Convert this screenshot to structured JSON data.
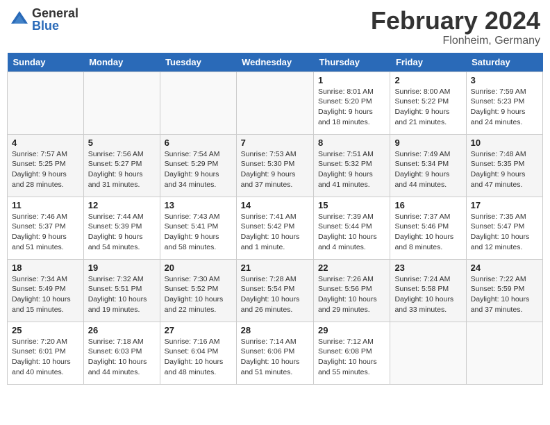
{
  "header": {
    "logo_general": "General",
    "logo_blue": "Blue",
    "month_year": "February 2024",
    "location": "Flonheim, Germany"
  },
  "days_of_week": [
    "Sunday",
    "Monday",
    "Tuesday",
    "Wednesday",
    "Thursday",
    "Friday",
    "Saturday"
  ],
  "weeks": [
    [
      {
        "day": "",
        "info": ""
      },
      {
        "day": "",
        "info": ""
      },
      {
        "day": "",
        "info": ""
      },
      {
        "day": "",
        "info": ""
      },
      {
        "day": "1",
        "info": "Sunrise: 8:01 AM\nSunset: 5:20 PM\nDaylight: 9 hours\nand 18 minutes."
      },
      {
        "day": "2",
        "info": "Sunrise: 8:00 AM\nSunset: 5:22 PM\nDaylight: 9 hours\nand 21 minutes."
      },
      {
        "day": "3",
        "info": "Sunrise: 7:59 AM\nSunset: 5:23 PM\nDaylight: 9 hours\nand 24 minutes."
      }
    ],
    [
      {
        "day": "4",
        "info": "Sunrise: 7:57 AM\nSunset: 5:25 PM\nDaylight: 9 hours\nand 28 minutes."
      },
      {
        "day": "5",
        "info": "Sunrise: 7:56 AM\nSunset: 5:27 PM\nDaylight: 9 hours\nand 31 minutes."
      },
      {
        "day": "6",
        "info": "Sunrise: 7:54 AM\nSunset: 5:29 PM\nDaylight: 9 hours\nand 34 minutes."
      },
      {
        "day": "7",
        "info": "Sunrise: 7:53 AM\nSunset: 5:30 PM\nDaylight: 9 hours\nand 37 minutes."
      },
      {
        "day": "8",
        "info": "Sunrise: 7:51 AM\nSunset: 5:32 PM\nDaylight: 9 hours\nand 41 minutes."
      },
      {
        "day": "9",
        "info": "Sunrise: 7:49 AM\nSunset: 5:34 PM\nDaylight: 9 hours\nand 44 minutes."
      },
      {
        "day": "10",
        "info": "Sunrise: 7:48 AM\nSunset: 5:35 PM\nDaylight: 9 hours\nand 47 minutes."
      }
    ],
    [
      {
        "day": "11",
        "info": "Sunrise: 7:46 AM\nSunset: 5:37 PM\nDaylight: 9 hours\nand 51 minutes."
      },
      {
        "day": "12",
        "info": "Sunrise: 7:44 AM\nSunset: 5:39 PM\nDaylight: 9 hours\nand 54 minutes."
      },
      {
        "day": "13",
        "info": "Sunrise: 7:43 AM\nSunset: 5:41 PM\nDaylight: 9 hours\nand 58 minutes."
      },
      {
        "day": "14",
        "info": "Sunrise: 7:41 AM\nSunset: 5:42 PM\nDaylight: 10 hours\nand 1 minute."
      },
      {
        "day": "15",
        "info": "Sunrise: 7:39 AM\nSunset: 5:44 PM\nDaylight: 10 hours\nand 4 minutes."
      },
      {
        "day": "16",
        "info": "Sunrise: 7:37 AM\nSunset: 5:46 PM\nDaylight: 10 hours\nand 8 minutes."
      },
      {
        "day": "17",
        "info": "Sunrise: 7:35 AM\nSunset: 5:47 PM\nDaylight: 10 hours\nand 12 minutes."
      }
    ],
    [
      {
        "day": "18",
        "info": "Sunrise: 7:34 AM\nSunset: 5:49 PM\nDaylight: 10 hours\nand 15 minutes."
      },
      {
        "day": "19",
        "info": "Sunrise: 7:32 AM\nSunset: 5:51 PM\nDaylight: 10 hours\nand 19 minutes."
      },
      {
        "day": "20",
        "info": "Sunrise: 7:30 AM\nSunset: 5:52 PM\nDaylight: 10 hours\nand 22 minutes."
      },
      {
        "day": "21",
        "info": "Sunrise: 7:28 AM\nSunset: 5:54 PM\nDaylight: 10 hours\nand 26 minutes."
      },
      {
        "day": "22",
        "info": "Sunrise: 7:26 AM\nSunset: 5:56 PM\nDaylight: 10 hours\nand 29 minutes."
      },
      {
        "day": "23",
        "info": "Sunrise: 7:24 AM\nSunset: 5:58 PM\nDaylight: 10 hours\nand 33 minutes."
      },
      {
        "day": "24",
        "info": "Sunrise: 7:22 AM\nSunset: 5:59 PM\nDaylight: 10 hours\nand 37 minutes."
      }
    ],
    [
      {
        "day": "25",
        "info": "Sunrise: 7:20 AM\nSunset: 6:01 PM\nDaylight: 10 hours\nand 40 minutes."
      },
      {
        "day": "26",
        "info": "Sunrise: 7:18 AM\nSunset: 6:03 PM\nDaylight: 10 hours\nand 44 minutes."
      },
      {
        "day": "27",
        "info": "Sunrise: 7:16 AM\nSunset: 6:04 PM\nDaylight: 10 hours\nand 48 minutes."
      },
      {
        "day": "28",
        "info": "Sunrise: 7:14 AM\nSunset: 6:06 PM\nDaylight: 10 hours\nand 51 minutes."
      },
      {
        "day": "29",
        "info": "Sunrise: 7:12 AM\nSunset: 6:08 PM\nDaylight: 10 hours\nand 55 minutes."
      },
      {
        "day": "",
        "info": ""
      },
      {
        "day": "",
        "info": ""
      }
    ]
  ]
}
